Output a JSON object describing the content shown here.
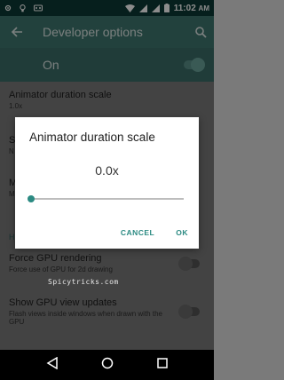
{
  "status_bar": {
    "time": "11:02",
    "time_suffix": "AM"
  },
  "app_bar": {
    "title": "Developer options"
  },
  "master": {
    "label": "On"
  },
  "list": [
    {
      "title": "Animator duration scale",
      "subtitle": "1.0x"
    },
    {
      "title": "S",
      "subtitle": "N"
    },
    {
      "title": "M",
      "subtitle": "M"
    },
    {
      "title": "H"
    },
    {
      "title": "Force GPU rendering",
      "subtitle": "Force use of GPU for 2d drawing"
    },
    {
      "title": "Show GPU view updates",
      "subtitle": "Flash views inside windows when drawn with the GPU"
    }
  ],
  "dialog": {
    "title": "Animator duration scale",
    "value": "0.0x",
    "slider_fraction": 0,
    "cancel": "CANCEL",
    "ok": "OK"
  },
  "watermark": "Spicytricks.com",
  "colors": {
    "accent": "#2b8a82",
    "scrim": "rgba(0,0,0,0.45)"
  }
}
